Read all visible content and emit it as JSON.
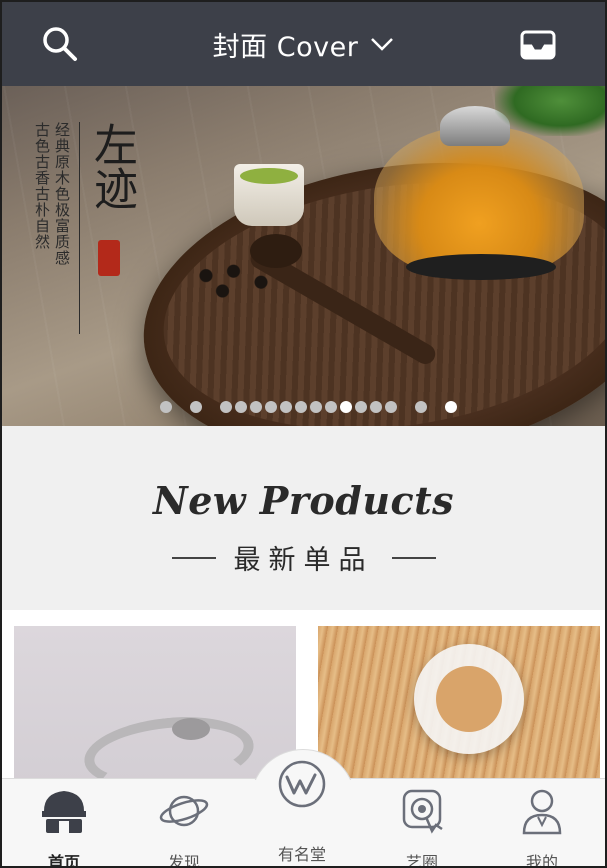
{
  "header": {
    "title": "封面 Cover",
    "search_icon": "search-icon",
    "dropdown_icon": "chevron-down-icon",
    "inbox_icon": "inbox-icon",
    "background": "#3d4049"
  },
  "banner": {
    "brand_name": "左迹",
    "slogan_line_1": "经典原木色极富质感",
    "slogan_line_2": "古色古香古朴自然",
    "seal_color": "#b3291a",
    "carousel": {
      "total_dots": 16,
      "active_index": 11
    }
  },
  "section": {
    "title_en": "New Products",
    "title_zh": "最新单品"
  },
  "products": [
    {
      "name": "silver-ring"
    },
    {
      "name": "cat-ring"
    }
  ],
  "tabbar": {
    "items": [
      {
        "label": "首页",
        "icon": "home-icon",
        "active": true
      },
      {
        "label": "发现",
        "icon": "planet-icon",
        "active": false
      },
      {
        "label": "有名堂",
        "icon": "brand-w-icon",
        "active": false
      },
      {
        "label": "艺圈",
        "icon": "target-icon",
        "active": false
      },
      {
        "label": "我的",
        "icon": "user-icon",
        "active": false
      }
    ]
  }
}
